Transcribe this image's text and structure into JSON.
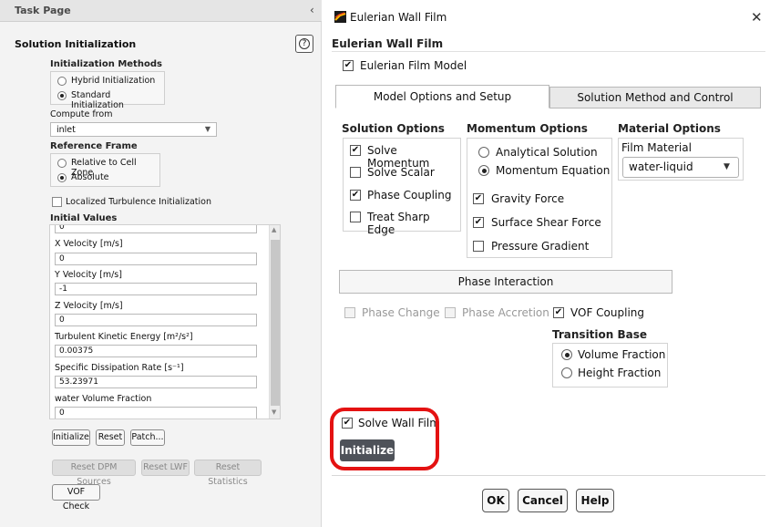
{
  "task_page": {
    "header": "Task Page",
    "collapse_glyph": "‹",
    "section_title": "Solution Initialization",
    "help_glyph": "?",
    "methods": {
      "label": "Initialization Methods",
      "options": [
        "Hybrid  Initialization",
        "Standard Initialization"
      ],
      "selected": "Standard Initialization"
    },
    "compute_from": {
      "label": "Compute from",
      "value": "inlet"
    },
    "reference_frame": {
      "label": "Reference Frame",
      "options": [
        "Relative to Cell Zone",
        "Absolute"
      ],
      "selected": "Absolute"
    },
    "localized_turbulence": {
      "label": "Localized Turbulence Initialization",
      "checked": false
    },
    "initial_values": {
      "label": "Initial Values",
      "top_partial_value": "0",
      "fields": [
        {
          "label": "X Velocity [m/s]",
          "value": "0"
        },
        {
          "label": "Y Velocity [m/s]",
          "value": "-1"
        },
        {
          "label": "Z Velocity [m/s]",
          "value": "0"
        },
        {
          "label": "Turbulent Kinetic Energy [m²/s²]",
          "value": "0.00375"
        },
        {
          "label": "Specific Dissipation Rate [s⁻¹]",
          "value": "53.23971"
        },
        {
          "label": "water Volume Fraction",
          "value": "0"
        }
      ]
    },
    "buttons": {
      "initialize": "Initialize",
      "reset": "Reset",
      "patch": "Patch...",
      "reset_dpm": "Reset DPM Sources",
      "reset_lwf": "Reset LWF",
      "reset_stats": "Reset Statistics",
      "vof_check": "VOF Check"
    }
  },
  "dialog": {
    "title": "Eulerian Wall Film",
    "close_glyph": "✕",
    "heading": "Eulerian Wall Film",
    "film_model": {
      "label": "Eulerian Film Model",
      "checked": true
    },
    "tabs": [
      "Model Options and Setup",
      "Solution Method and Control"
    ],
    "active_tab": "Model Options and Setup",
    "solution_options": {
      "title": "Solution Options",
      "items": [
        {
          "label": "Solve Momentum",
          "checked": true
        },
        {
          "label": "Solve Scalar",
          "checked": false
        },
        {
          "label": "Phase Coupling",
          "checked": true
        },
        {
          "label": "Treat Sharp Edge",
          "checked": false
        }
      ]
    },
    "momentum_options": {
      "title": "Momentum Options",
      "radios": [
        "Analytical Solution",
        "Momentum Equation"
      ],
      "selected": "Momentum Equation",
      "checks": [
        {
          "label": "Gravity Force",
          "checked": true
        },
        {
          "label": "Surface Shear Force",
          "checked": true
        },
        {
          "label": "Pressure Gradient",
          "checked": false
        }
      ]
    },
    "material_options": {
      "title": "Material Options",
      "film_material_label": "Film Material",
      "film_material": "water-liquid"
    },
    "phase_interaction": "Phase Interaction",
    "phase_row": {
      "phase_change": "Phase Change",
      "phase_accretion": "Phase Accretion",
      "vof_coupling": "VOF Coupling"
    },
    "transition_base": {
      "title": "Transition Base",
      "options": [
        "Volume Fraction",
        "Height Fraction"
      ],
      "selected": "Volume Fraction"
    },
    "solve_wall_film": {
      "label": "Solve Wall Film",
      "checked": true
    },
    "initialize_button": "Initialize",
    "footer": {
      "ok": "OK",
      "cancel": "Cancel",
      "help": "Help"
    },
    "highlight_color": "#e41212",
    "check_glyph": "✔"
  }
}
